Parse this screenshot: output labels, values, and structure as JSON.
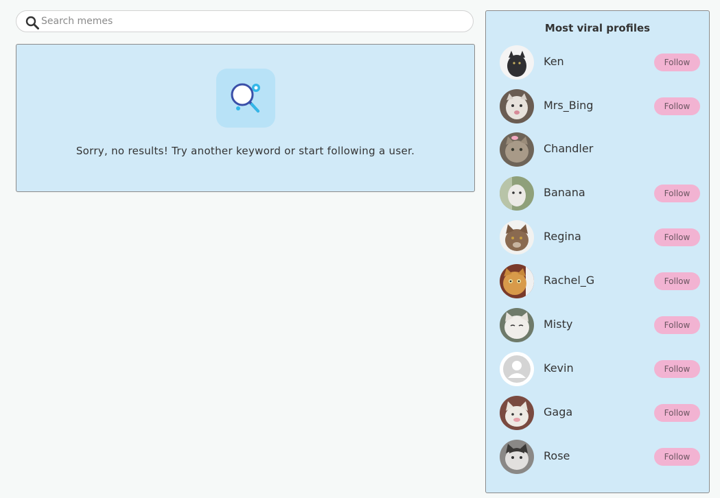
{
  "search": {
    "placeholder": "Search memes",
    "value": "",
    "icon": "search-icon"
  },
  "results": {
    "empty_message": "Sorry, no results! Try another keyword or start following a user.",
    "icon": "magnifier-illustration-icon"
  },
  "viral": {
    "title": "Most viral profiles",
    "follow_label": "Follow",
    "profiles": [
      {
        "name": "Ken",
        "show_follow": true,
        "avatar_color": "#3a3a3c"
      },
      {
        "name": "Mrs_Bing",
        "show_follow": true,
        "avatar_color": "#a99a8e"
      },
      {
        "name": "Chandler",
        "show_follow": false,
        "avatar_color": "#8c8070"
      },
      {
        "name": "Banana",
        "show_follow": true,
        "avatar_color": "#9fb08e"
      },
      {
        "name": "Regina",
        "show_follow": true,
        "avatar_color": "#9a7a60"
      },
      {
        "name": "Rachel_G",
        "show_follow": true,
        "avatar_color": "#c88a3a"
      },
      {
        "name": "Misty",
        "show_follow": true,
        "avatar_color": "#d8d8d4"
      },
      {
        "name": "Kevin",
        "show_follow": true,
        "avatar_color": "#c8c8c8"
      },
      {
        "name": "Gaga",
        "show_follow": true,
        "avatar_color": "#8a5a52"
      },
      {
        "name": "Rose",
        "show_follow": true,
        "avatar_color": "#b0aeac"
      }
    ]
  },
  "colors": {
    "panel_bg": "#d1eaf8",
    "follow_bg": "#f2b3d2",
    "page_bg": "#f6f9f8"
  }
}
